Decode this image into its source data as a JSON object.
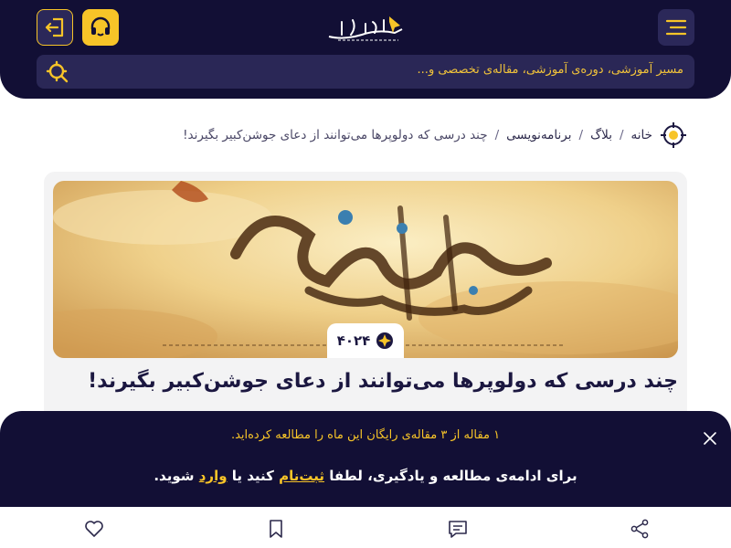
{
  "header": {
    "logo_text": "راکت آکادمی",
    "search_placeholder": "مسیر آموزشی، دوره‌ی آموزشی، مقاله‌ی تخصصی و..."
  },
  "breadcrumb": {
    "items": [
      "خانه",
      "بلاگ",
      "برنامه‌نویسی"
    ],
    "current": "چند درسی که دولوپرها می‌توانند از دعای جوشن‌کبیر بگیرند!",
    "separator": "/"
  },
  "article": {
    "title": "چند درسی که دولوپرها می‌توانند از دعای جوشن‌کبیر بگیرند!",
    "views": "۴۰۲۴",
    "hero_calligraphy": "شهر رمضان"
  },
  "paywall": {
    "quota_text": "۱ مقاله از ۳ مقاله‌ی رایگان این ماه را مطالعه کرده‌اید.",
    "prompt_before": "برای ادامه‌ی مطالعه و یادگیری، لطفا ",
    "signup_label": "ثبت‌نام",
    "prompt_middle": " کنید یا ",
    "login_label": "وارد",
    "prompt_after": " شوید."
  },
  "icons": {
    "login": "login-icon",
    "support": "headset-icon",
    "menu": "hamburger-icon",
    "search": "search-icon",
    "breadcrumb": "target-icon",
    "close": "close-icon",
    "like": "heart-icon",
    "bookmark": "bookmark-icon",
    "comments": "comment-icon",
    "share": "share-icon"
  },
  "colors": {
    "navy": "#120f35",
    "accent": "#f7c428",
    "search_bg": "#2a2756"
  }
}
